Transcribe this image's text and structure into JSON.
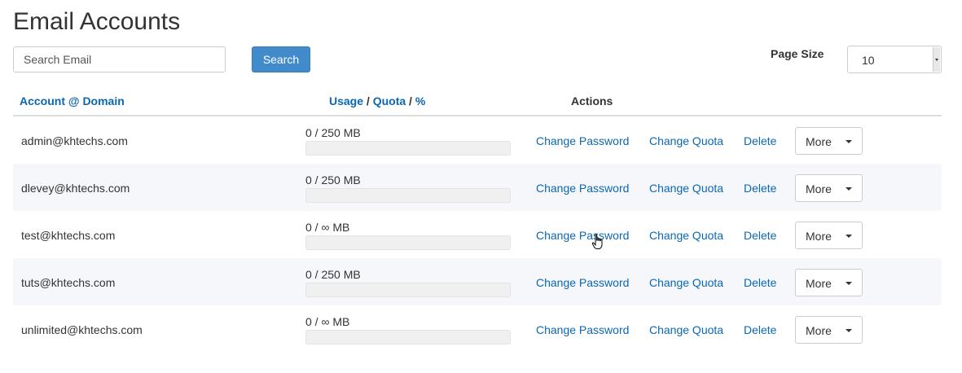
{
  "page": {
    "title": "Email Accounts"
  },
  "search": {
    "placeholder": "Search Email",
    "button_label": "Search"
  },
  "page_size": {
    "label": "Page Size",
    "selected": "10"
  },
  "table": {
    "headers": {
      "account": "Account",
      "at": "@",
      "domain": "Domain",
      "usage": "Usage",
      "sep": "/",
      "quota": "Quota",
      "percent": "%",
      "actions": "Actions"
    },
    "rows": [
      {
        "email": "admin@khtechs.com",
        "usage": "0 / 250 MB",
        "usage_fraction": 0,
        "change_password": "Change Password",
        "change_quota": "Change Quota",
        "delete": "Delete",
        "more": "More"
      },
      {
        "email": "dlevey@khtechs.com",
        "usage": "0 / 250 MB",
        "usage_fraction": 0,
        "change_password": "Change Password",
        "change_quota": "Change Quota",
        "delete": "Delete",
        "more": "More"
      },
      {
        "email": "test@khtechs.com",
        "usage": "0 / ∞ MB",
        "usage_fraction": 0,
        "change_password": "Change Password",
        "change_quota": "Change Quota",
        "delete": "Delete",
        "more": "More"
      },
      {
        "email": "tuts@khtechs.com",
        "usage": "0 / 250 MB",
        "usage_fraction": 0,
        "change_password": "Change Password",
        "change_quota": "Change Quota",
        "delete": "Delete",
        "more": "More"
      },
      {
        "email": "unlimited@khtechs.com",
        "usage": "0 / ∞ MB",
        "usage_fraction": 0,
        "change_password": "Change Password",
        "change_quota": "Change Quota",
        "delete": "Delete",
        "more": "More"
      }
    ]
  },
  "colors": {
    "link": "#0b67b2",
    "primary_button": "#428bca",
    "stripe": "#f5f7fa"
  },
  "icons": {
    "dropdown": "caret-down-icon",
    "cursor": "hand-pointer-icon"
  }
}
